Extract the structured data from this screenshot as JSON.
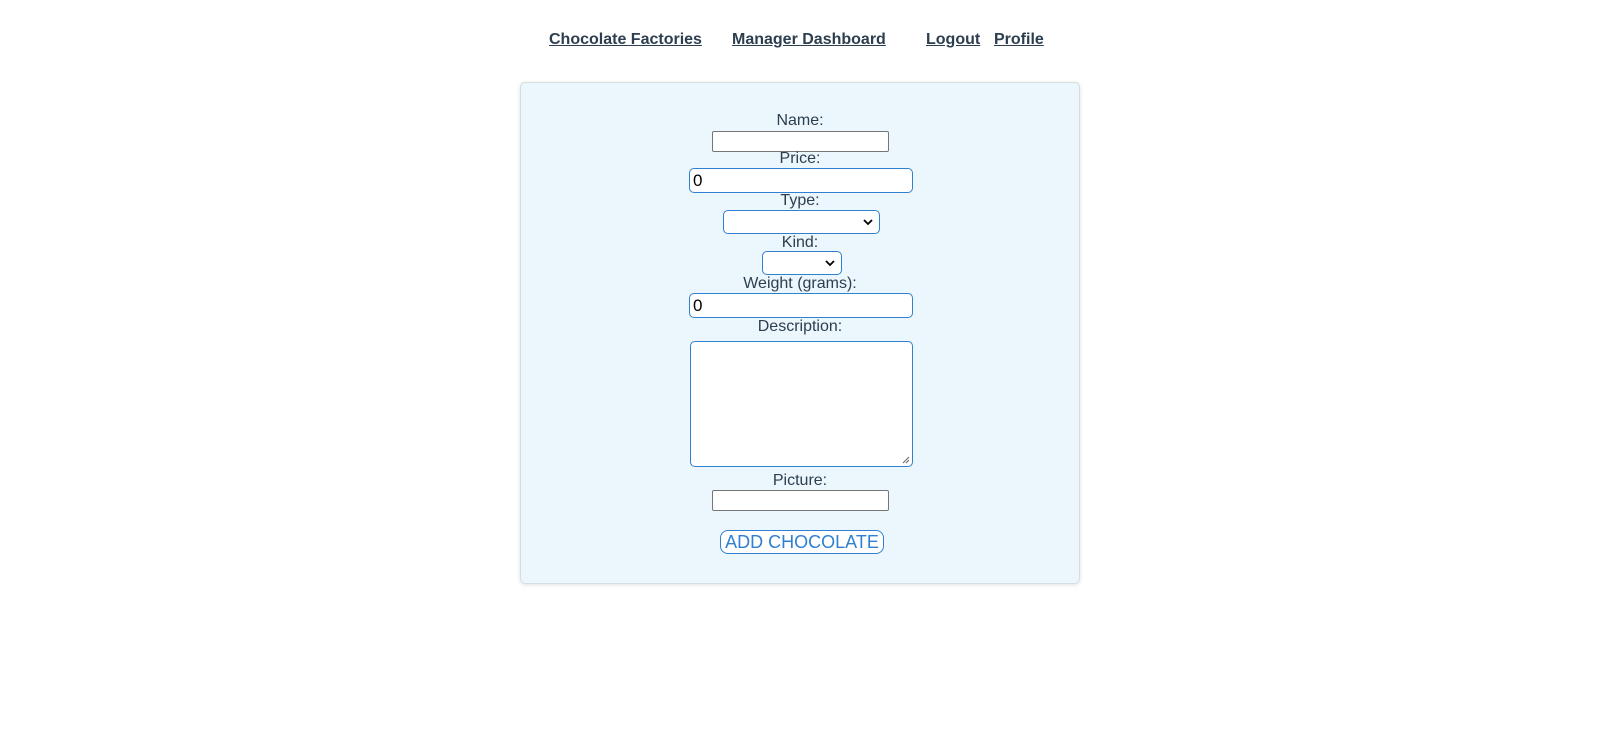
{
  "nav": {
    "links": [
      {
        "label": "Chocolate Factories"
      },
      {
        "label": "Manager Dashboard"
      },
      {
        "label": "Logout"
      },
      {
        "label": "Profile"
      }
    ]
  },
  "form": {
    "name": {
      "label": "Name:",
      "value": ""
    },
    "price": {
      "label": "Price:",
      "value": "0"
    },
    "type": {
      "label": "Type:",
      "selected": ""
    },
    "kind": {
      "label": "Kind:",
      "selected": ""
    },
    "weight": {
      "label": "Weight (grams):",
      "value": "0"
    },
    "description": {
      "label": "Description:",
      "value": ""
    },
    "picture": {
      "label": "Picture:",
      "value": ""
    },
    "submit_label": "ADD CHOCOLATE"
  },
  "colors": {
    "text": "#2c3e50",
    "accent": "#2f80d1",
    "card_background": "#ecf6fd"
  },
  "icons": {
    "select_arrow": "chevron-down-icon",
    "textarea_grip": "resize-grip-icon"
  }
}
